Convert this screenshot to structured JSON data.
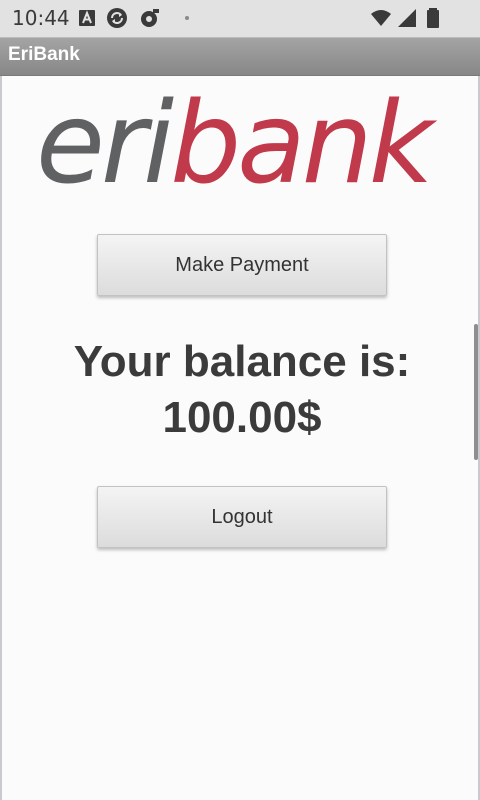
{
  "status_bar": {
    "time": "10:44"
  },
  "app_bar": {
    "title": "EriBank"
  },
  "logo": {
    "part1": "eri",
    "part2": "bank",
    "colors": {
      "eri": "#5f6163",
      "bank": "#c03a4c"
    }
  },
  "buttons": {
    "make_payment": "Make Payment",
    "logout": "Logout"
  },
  "balance": {
    "label": "Your balance is:",
    "amount": "100.00$"
  },
  "icons": {
    "status": [
      "text-a-icon",
      "sync-icon",
      "debug-icon",
      "dot-icon",
      "wifi-icon",
      "signal-icon",
      "battery-icon"
    ]
  }
}
